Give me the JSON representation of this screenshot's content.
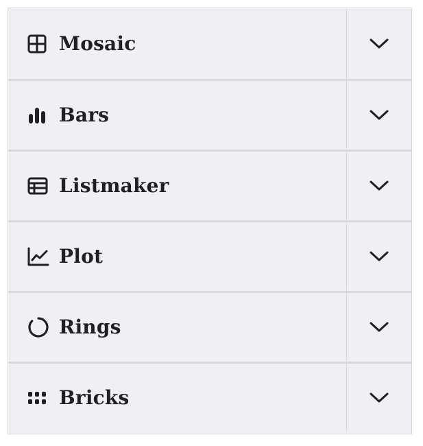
{
  "accordion": {
    "items": [
      {
        "label": "Mosaic",
        "icon": "grid-icon",
        "expanded": false
      },
      {
        "label": "Bars",
        "icon": "bar-chart-icon",
        "expanded": false
      },
      {
        "label": "Listmaker",
        "icon": "table-icon",
        "expanded": false
      },
      {
        "label": "Plot",
        "icon": "line-chart-icon",
        "expanded": false
      },
      {
        "label": "Rings",
        "icon": "ring-icon",
        "expanded": false
      },
      {
        "label": "Bricks",
        "icon": "bricks-icon",
        "expanded": false
      }
    ],
    "toggle_icon": "chevron-down-icon",
    "colors": {
      "background": "#eff0f4",
      "border": "#d8d9de",
      "text": "#1f2023"
    }
  }
}
